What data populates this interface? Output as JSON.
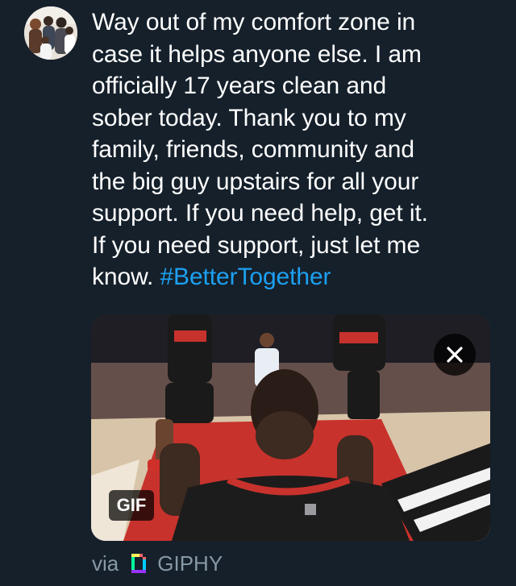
{
  "tweet": {
    "lines": [
      "Way out of my comfort zone in",
      "case it helps anyone else. I am",
      "officially 17 years clean and",
      "sober today. Thank you to my",
      "family, friends, community and",
      "the big guy upstairs for all your",
      "support. If you need help, get it.",
      "If you need support, just let me"
    ],
    "last_line_text": "know. ",
    "hashtag": "#BetterTogether"
  },
  "media": {
    "badge": "GIF",
    "close_glyph": "✕",
    "close_icon": "close-icon"
  },
  "attribution": {
    "via_label": "via",
    "provider": "GIPHY",
    "provider_icon": "giphy-icon"
  },
  "colors": {
    "background": "#15202b",
    "text": "#ffffff",
    "hashtag": "#1da1f2",
    "muted": "#8899a6"
  }
}
